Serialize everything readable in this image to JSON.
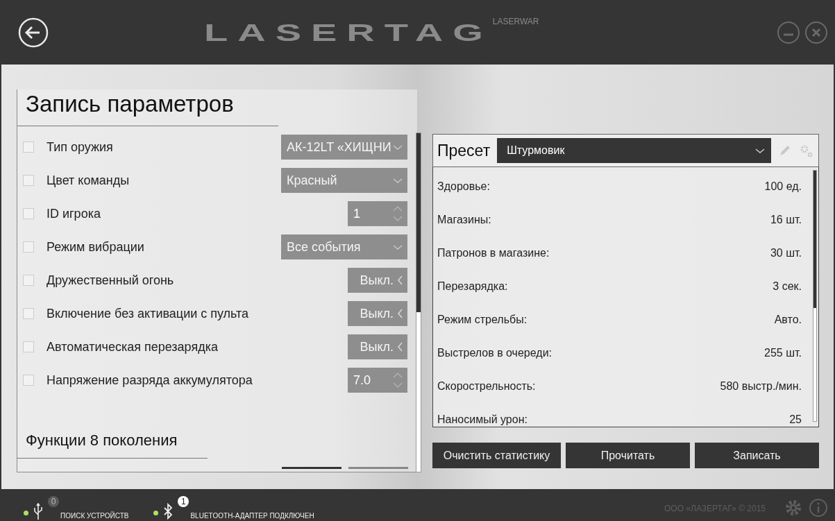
{
  "header": {
    "logo": "LASERTAG",
    "brand": "LASERWAR"
  },
  "params": {
    "title": "Запись параметров",
    "rows": [
      {
        "label": "Тип оружия",
        "checked": false,
        "kind": "dropdown",
        "value": "АК-12LT «ХИЩНИ"
      },
      {
        "label": "Цвет команды",
        "checked": false,
        "kind": "dropdown",
        "value": "Красный"
      },
      {
        "label": "ID игрока",
        "checked": false,
        "kind": "spin",
        "value": "1"
      },
      {
        "label": "Режим вибрации",
        "checked": false,
        "kind": "dropdown",
        "value": "Все события"
      },
      {
        "label": "Дружественный огонь",
        "checked": false,
        "kind": "toggle",
        "value": "Выкл.",
        "on": false
      },
      {
        "label": "Включение без активации с пульта",
        "checked": false,
        "kind": "toggle",
        "value": "Выкл.",
        "on": false
      },
      {
        "label": "Автоматическая перезарядка",
        "checked": false,
        "kind": "toggle",
        "value": "Выкл.",
        "on": false
      },
      {
        "label": "Напряжение разряда аккумулятора",
        "checked": false,
        "kind": "spin",
        "value": "7.0"
      }
    ],
    "section": "Функции 8 поколения"
  },
  "preset": {
    "label": "Пресет",
    "value": "Штурмовик",
    "stats": [
      {
        "name": "Здоровье:",
        "value": "100 ед."
      },
      {
        "name": "Магазины:",
        "value": "16 шт."
      },
      {
        "name": "Патронов в магазине:",
        "value": "30 шт."
      },
      {
        "name": "Перезарядка:",
        "value": "3 сек."
      },
      {
        "name": "Режим стрельбы:",
        "value": "Авто."
      },
      {
        "name": "Выстрелов в очереди:",
        "value": "255 шт."
      },
      {
        "name": "Скорострельность:",
        "value": "580 выстр./мин."
      },
      {
        "name": "Наносимый урон:",
        "value": "25"
      }
    ],
    "buttons": [
      "Очистить статистику",
      "Прочитать",
      "Записать"
    ]
  },
  "status_bar": {
    "devices": [
      {
        "kind": "usb",
        "count": "0",
        "label": "ПОИСК УСТРОЙСТВ",
        "active": false
      },
      {
        "kind": "bluetooth",
        "count": "1",
        "label": "BLUETOOTH-АДАПТЕР ПОДКЛЮЧЕН",
        "active": true
      }
    ],
    "copyright": "ООО «ЛАЗЕРТАГ» © 2015"
  }
}
